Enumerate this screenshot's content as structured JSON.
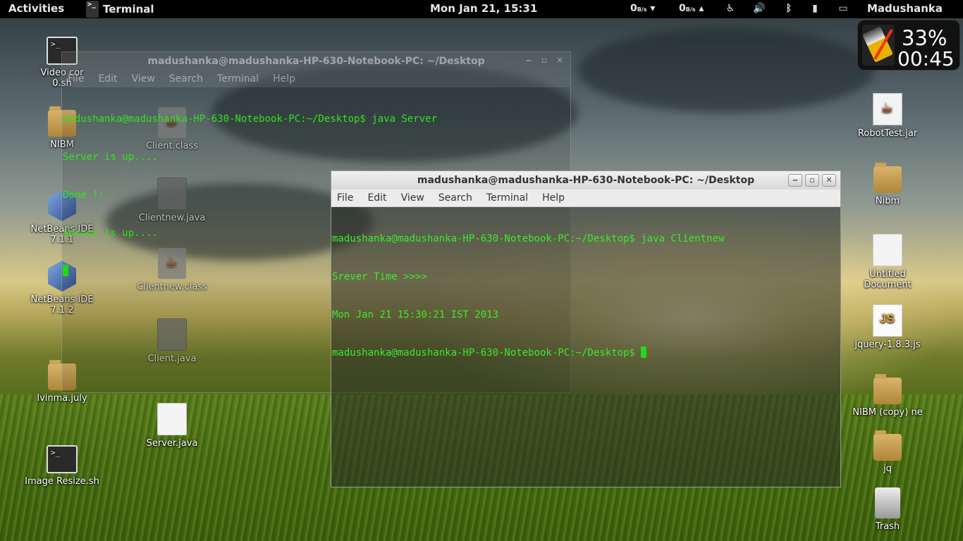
{
  "panel": {
    "activities": "Activities",
    "app_name": "Terminal",
    "clock": "Mon Jan 21, 15:31",
    "net_down": "0",
    "net_down_unit": "B/s",
    "net_up": "0",
    "net_up_unit": "B/s",
    "user": "Madushanka"
  },
  "battery_widget": {
    "percent": "33%",
    "time": "00:45"
  },
  "desktop_left": [
    {
      "label": "Video cor",
      "sub": "0.sh"
    },
    {
      "label": "NIBM"
    },
    {
      "label": "NetBeans IDE 7.1.1"
    },
    {
      "label": "NetBeans IDE 7.1.2"
    },
    {
      "label": "lvinma.july"
    },
    {
      "label": "Image Resize.sh"
    }
  ],
  "desktop_mid": [
    {
      "label": "Client.class"
    },
    {
      "label": "Clientnew.java"
    },
    {
      "label": "Clientnew.class"
    },
    {
      "label": "Client.java"
    },
    {
      "label": "Server.java"
    }
  ],
  "desktop_right": [
    {
      "label": "RobotTest.jar"
    },
    {
      "label": "Nibm"
    },
    {
      "label": "Untitled Document"
    },
    {
      "label": "jquery-1.8.3.js"
    },
    {
      "label": "NIBM (copy) ne"
    },
    {
      "label": "jq"
    },
    {
      "label": "Trash"
    }
  ],
  "window1": {
    "title": "madushanka@madushanka-HP-630-Notebook-PC: ~/Desktop",
    "menu": [
      "File",
      "Edit",
      "View",
      "Search",
      "Terminal",
      "Help"
    ],
    "lines": [
      "madushanka@madushanka-HP-630-Notebook-PC:~/Desktop$ java Server",
      "Server is up....",
      "Done !!",
      "Server is up...."
    ]
  },
  "window2": {
    "title": "madushanka@madushanka-HP-630-Notebook-PC: ~/Desktop",
    "menu": [
      "File",
      "Edit",
      "View",
      "Search",
      "Terminal",
      "Help"
    ],
    "lines": [
      "madushanka@madushanka-HP-630-Notebook-PC:~/Desktop$ java Clientnew",
      "Srever Time >>>>",
      "Mon Jan 21 15:30:21 IST 2013",
      "madushanka@madushanka-HP-630-Notebook-PC:~/Desktop$ "
    ]
  }
}
